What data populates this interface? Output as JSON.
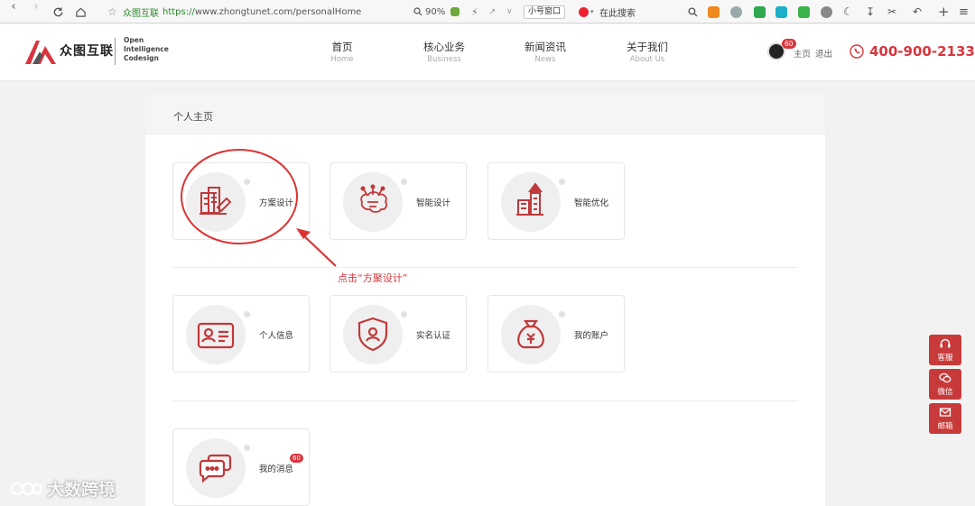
{
  "browser": {
    "site_name": "众图互联",
    "url_https": "https://",
    "url_rest": "www.zhongtunet.com/personalHome",
    "zoom": "90%",
    "small_window_label": "小号窗口",
    "search_placeholder": "在此搜索"
  },
  "header": {
    "logo_cn": "众图互联",
    "logo_en_1": "Open",
    "logo_en_2": "Intelligence",
    "logo_en_3": "Codesign",
    "nav": [
      {
        "cn": "首页",
        "en": "Home"
      },
      {
        "cn": "核心业务",
        "en": "Business"
      },
      {
        "cn": "新闻资讯",
        "en": "News"
      },
      {
        "cn": "关于我们",
        "en": "About Us"
      }
    ],
    "avatar_badge": "60",
    "home_link": "主页",
    "logout_link": "退出",
    "phone": "400-900-2133"
  },
  "panel": {
    "title": "个人主页",
    "cards": [
      {
        "label": "方案设计",
        "icon": "blueprint-icon"
      },
      {
        "label": "智能设计",
        "icon": "brain-circuit-icon"
      },
      {
        "label": "智能优化",
        "icon": "building-growth-icon"
      },
      {
        "label": "个人信息",
        "icon": "id-card-icon"
      },
      {
        "label": "实名认证",
        "icon": "shield-check-icon"
      },
      {
        "label": "我的账户",
        "icon": "money-bag-icon"
      },
      {
        "label": "我的消息",
        "icon": "chat-bubbles-icon",
        "badge": "60"
      }
    ]
  },
  "annotation": {
    "text": "点击“方聚设计”"
  },
  "side_buttons": [
    {
      "label": "客服",
      "icon": "headset-icon"
    },
    {
      "label": "微信",
      "icon": "wechat-icon"
    },
    {
      "label": "邮箱",
      "icon": "mail-icon"
    }
  ],
  "watermark": "大数跨境",
  "colors": {
    "accent": "#d9363e",
    "side_button": "#c83a3a"
  }
}
